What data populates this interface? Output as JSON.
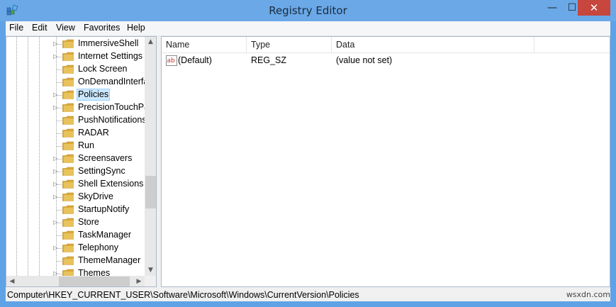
{
  "window": {
    "title": "Registry Editor",
    "close_glyph": "✕",
    "minimize_glyph": "—",
    "maximize_glyph": "☐"
  },
  "menu": [
    "File",
    "Edit",
    "View",
    "Favorites",
    "Help"
  ],
  "tree": {
    "items": [
      {
        "label": "ImmersiveShell",
        "expandable": true,
        "selected": false
      },
      {
        "label": "Internet Settings",
        "expandable": true,
        "selected": false
      },
      {
        "label": "Lock Screen",
        "expandable": false,
        "selected": false
      },
      {
        "label": "OnDemandInterfa",
        "expandable": false,
        "selected": false
      },
      {
        "label": "Policies",
        "expandable": true,
        "selected": true
      },
      {
        "label": "PrecisionTouchPa",
        "expandable": true,
        "selected": false
      },
      {
        "label": "PushNotifications",
        "expandable": false,
        "selected": false
      },
      {
        "label": "RADAR",
        "expandable": false,
        "selected": false
      },
      {
        "label": "Run",
        "expandable": false,
        "selected": false
      },
      {
        "label": "Screensavers",
        "expandable": true,
        "selected": false
      },
      {
        "label": "SettingSync",
        "expandable": true,
        "selected": false
      },
      {
        "label": "Shell Extensions",
        "expandable": true,
        "selected": false
      },
      {
        "label": "SkyDrive",
        "expandable": true,
        "selected": false
      },
      {
        "label": "StartupNotify",
        "expandable": false,
        "selected": false
      },
      {
        "label": "Store",
        "expandable": true,
        "selected": false
      },
      {
        "label": "TaskManager",
        "expandable": false,
        "selected": false
      },
      {
        "label": "Telephony",
        "expandable": true,
        "selected": false
      },
      {
        "label": "ThemeManager",
        "expandable": false,
        "selected": false
      },
      {
        "label": "Themes",
        "expandable": true,
        "selected": false
      }
    ]
  },
  "list": {
    "columns": [
      "Name",
      "Type",
      "Data"
    ],
    "rows": [
      {
        "icon": "string-value-icon",
        "icon_text": "ab",
        "name": "(Default)",
        "type": "REG_SZ",
        "data": "(value not set)"
      }
    ]
  },
  "statusbar": {
    "path": "Computer\\HKEY_CURRENT_USER\\Software\\Microsoft\\Windows\\CurrentVersion\\Policies"
  },
  "watermark": "wsxdn.com",
  "colors": {
    "title_bar": "#6aa8e8",
    "close_button": "#c7463d",
    "selection_bg": "#cce8ff",
    "folder": "#e8c25a"
  }
}
